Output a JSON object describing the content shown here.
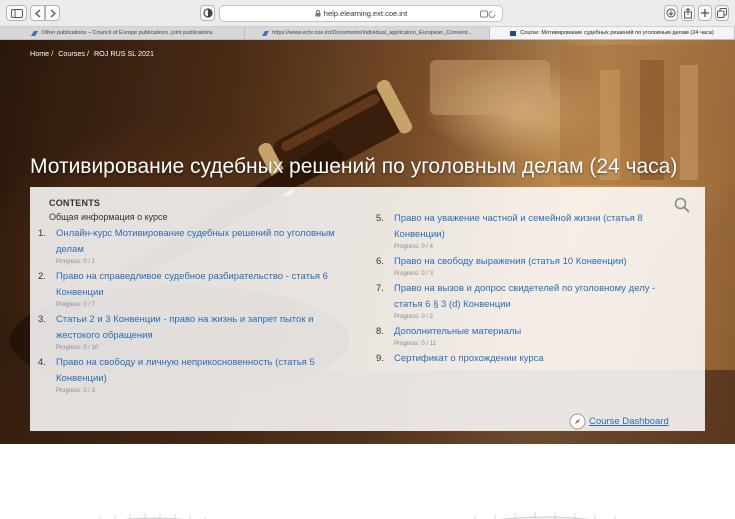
{
  "browser": {
    "url": "help.elearning.ext.coe.int",
    "tabs": [
      {
        "label": "Other publications – Council of Europe publications, joint publications",
        "active": false
      },
      {
        "label": "https://www.echr.coe.int/Documents/Individual_application_European_Convent...",
        "active": false
      },
      {
        "label": "Course: Мотивирование судебных решений по уголовным делам (24 часа)",
        "active": true
      }
    ]
  },
  "breadcrumb": {
    "home": "Home",
    "courses": "Courses",
    "current": "ROJ RUS SL 2021",
    "sep": "/"
  },
  "course_title": "Мотивирование судебных решений по уголовным делам (24 часа)",
  "contents": {
    "heading": "CONTENTS",
    "general": "Общая информация о курсе",
    "left_items": [
      {
        "num": "1.",
        "lines": [
          "Онлайн-курс Мотивирование судебных решений по уголовным",
          "делам"
        ],
        "progress": "Progress: 0 / 1"
      },
      {
        "num": "2.",
        "lines": [
          "Право на справедливое судебное разбирательство - статья 6",
          "Конвенции"
        ],
        "progress": "Progress: 0 / 7"
      },
      {
        "num": "3.",
        "lines": [
          "Статьи 2 и 3 Конвенции - право на жизнь и запрет пыток и",
          "жестокого обращения"
        ],
        "progress": "Progress: 0 / 10"
      },
      {
        "num": "4.",
        "lines": [
          "Право на свободу и личную неприкосновенность (статья 5",
          "Конвенции)"
        ],
        "progress": "Progress: 0 / 3"
      }
    ],
    "right_items": [
      {
        "num": "5.",
        "lines": [
          "Право на уважение частной и семейной жизни (статья 8",
          "Конвенции)"
        ],
        "progress": "Progress: 0 / 4"
      },
      {
        "num": "6.",
        "lines": [
          "Право на свободу выражения (статья 10 Конвенции)"
        ],
        "progress": "Progress: 0 / 3"
      },
      {
        "num": "7.",
        "lines": [
          "Право на вызов и допрос свидетелей по уголовному делу -",
          "статья 6 § 3 (d) Конвенции"
        ],
        "progress": "Progress: 0 / 2"
      },
      {
        "num": "8.",
        "lines": [
          "Дополнительные материалы"
        ],
        "progress": "Progress: 0 / 11"
      },
      {
        "num": "9.",
        "lines": [
          "Сертификат о прохождении курса"
        ],
        "progress": ""
      }
    ],
    "dashboard_label": "Course Dashboard"
  },
  "colors": {
    "link": "#2a6db3",
    "text": "#333333"
  }
}
